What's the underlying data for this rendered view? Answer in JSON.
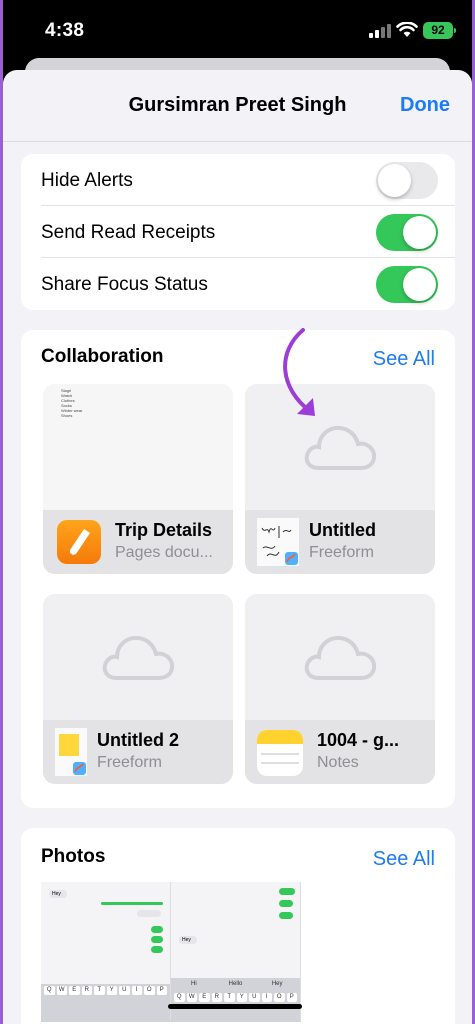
{
  "status_bar": {
    "time": "4:38",
    "battery": "92"
  },
  "nav": {
    "title": "Gursimran Preet Singh",
    "done_label": "Done"
  },
  "settings": [
    {
      "label": "Hide Alerts",
      "on": false
    },
    {
      "label": "Send Read Receipts",
      "on": true
    },
    {
      "label": "Share Focus Status",
      "on": true
    }
  ],
  "collaboration": {
    "title": "Collaboration",
    "see_all": "See All",
    "items": [
      {
        "name": "Trip Details",
        "subtitle": "Pages docu...",
        "icon": "pages-app-icon"
      },
      {
        "name": "Untitled",
        "subtitle": "Freeform",
        "icon": "freeform-icon"
      },
      {
        "name": "Untitled 2",
        "subtitle": "Freeform",
        "icon": "freeform-icon"
      },
      {
        "name": "1004 - g...",
        "subtitle": "Notes",
        "icon": "notes-app-icon"
      }
    ],
    "doc_preview_lines": [
      "Slagri",
      "Watch",
      "Clothes",
      "Socks",
      "Winter wear",
      "Shoes"
    ]
  },
  "photos": {
    "title": "Photos",
    "see_all": "See All",
    "screenshot1": {
      "bubble": "Hey",
      "keyboard_row": [
        "Q",
        "W",
        "E",
        "R",
        "T",
        "Y",
        "U",
        "I",
        "O",
        "P"
      ]
    },
    "screenshot2": {
      "bubble": "Hey",
      "suggestions": [
        "Hi",
        "Hello",
        "Hey"
      ],
      "keyboard_row": [
        "Q",
        "W",
        "E",
        "R",
        "T",
        "Y",
        "U",
        "I",
        "O",
        "P"
      ]
    }
  },
  "colors": {
    "accent": "#1d7bf5",
    "toggle_on": "#34c759",
    "arrow": "#9b3dd6"
  }
}
